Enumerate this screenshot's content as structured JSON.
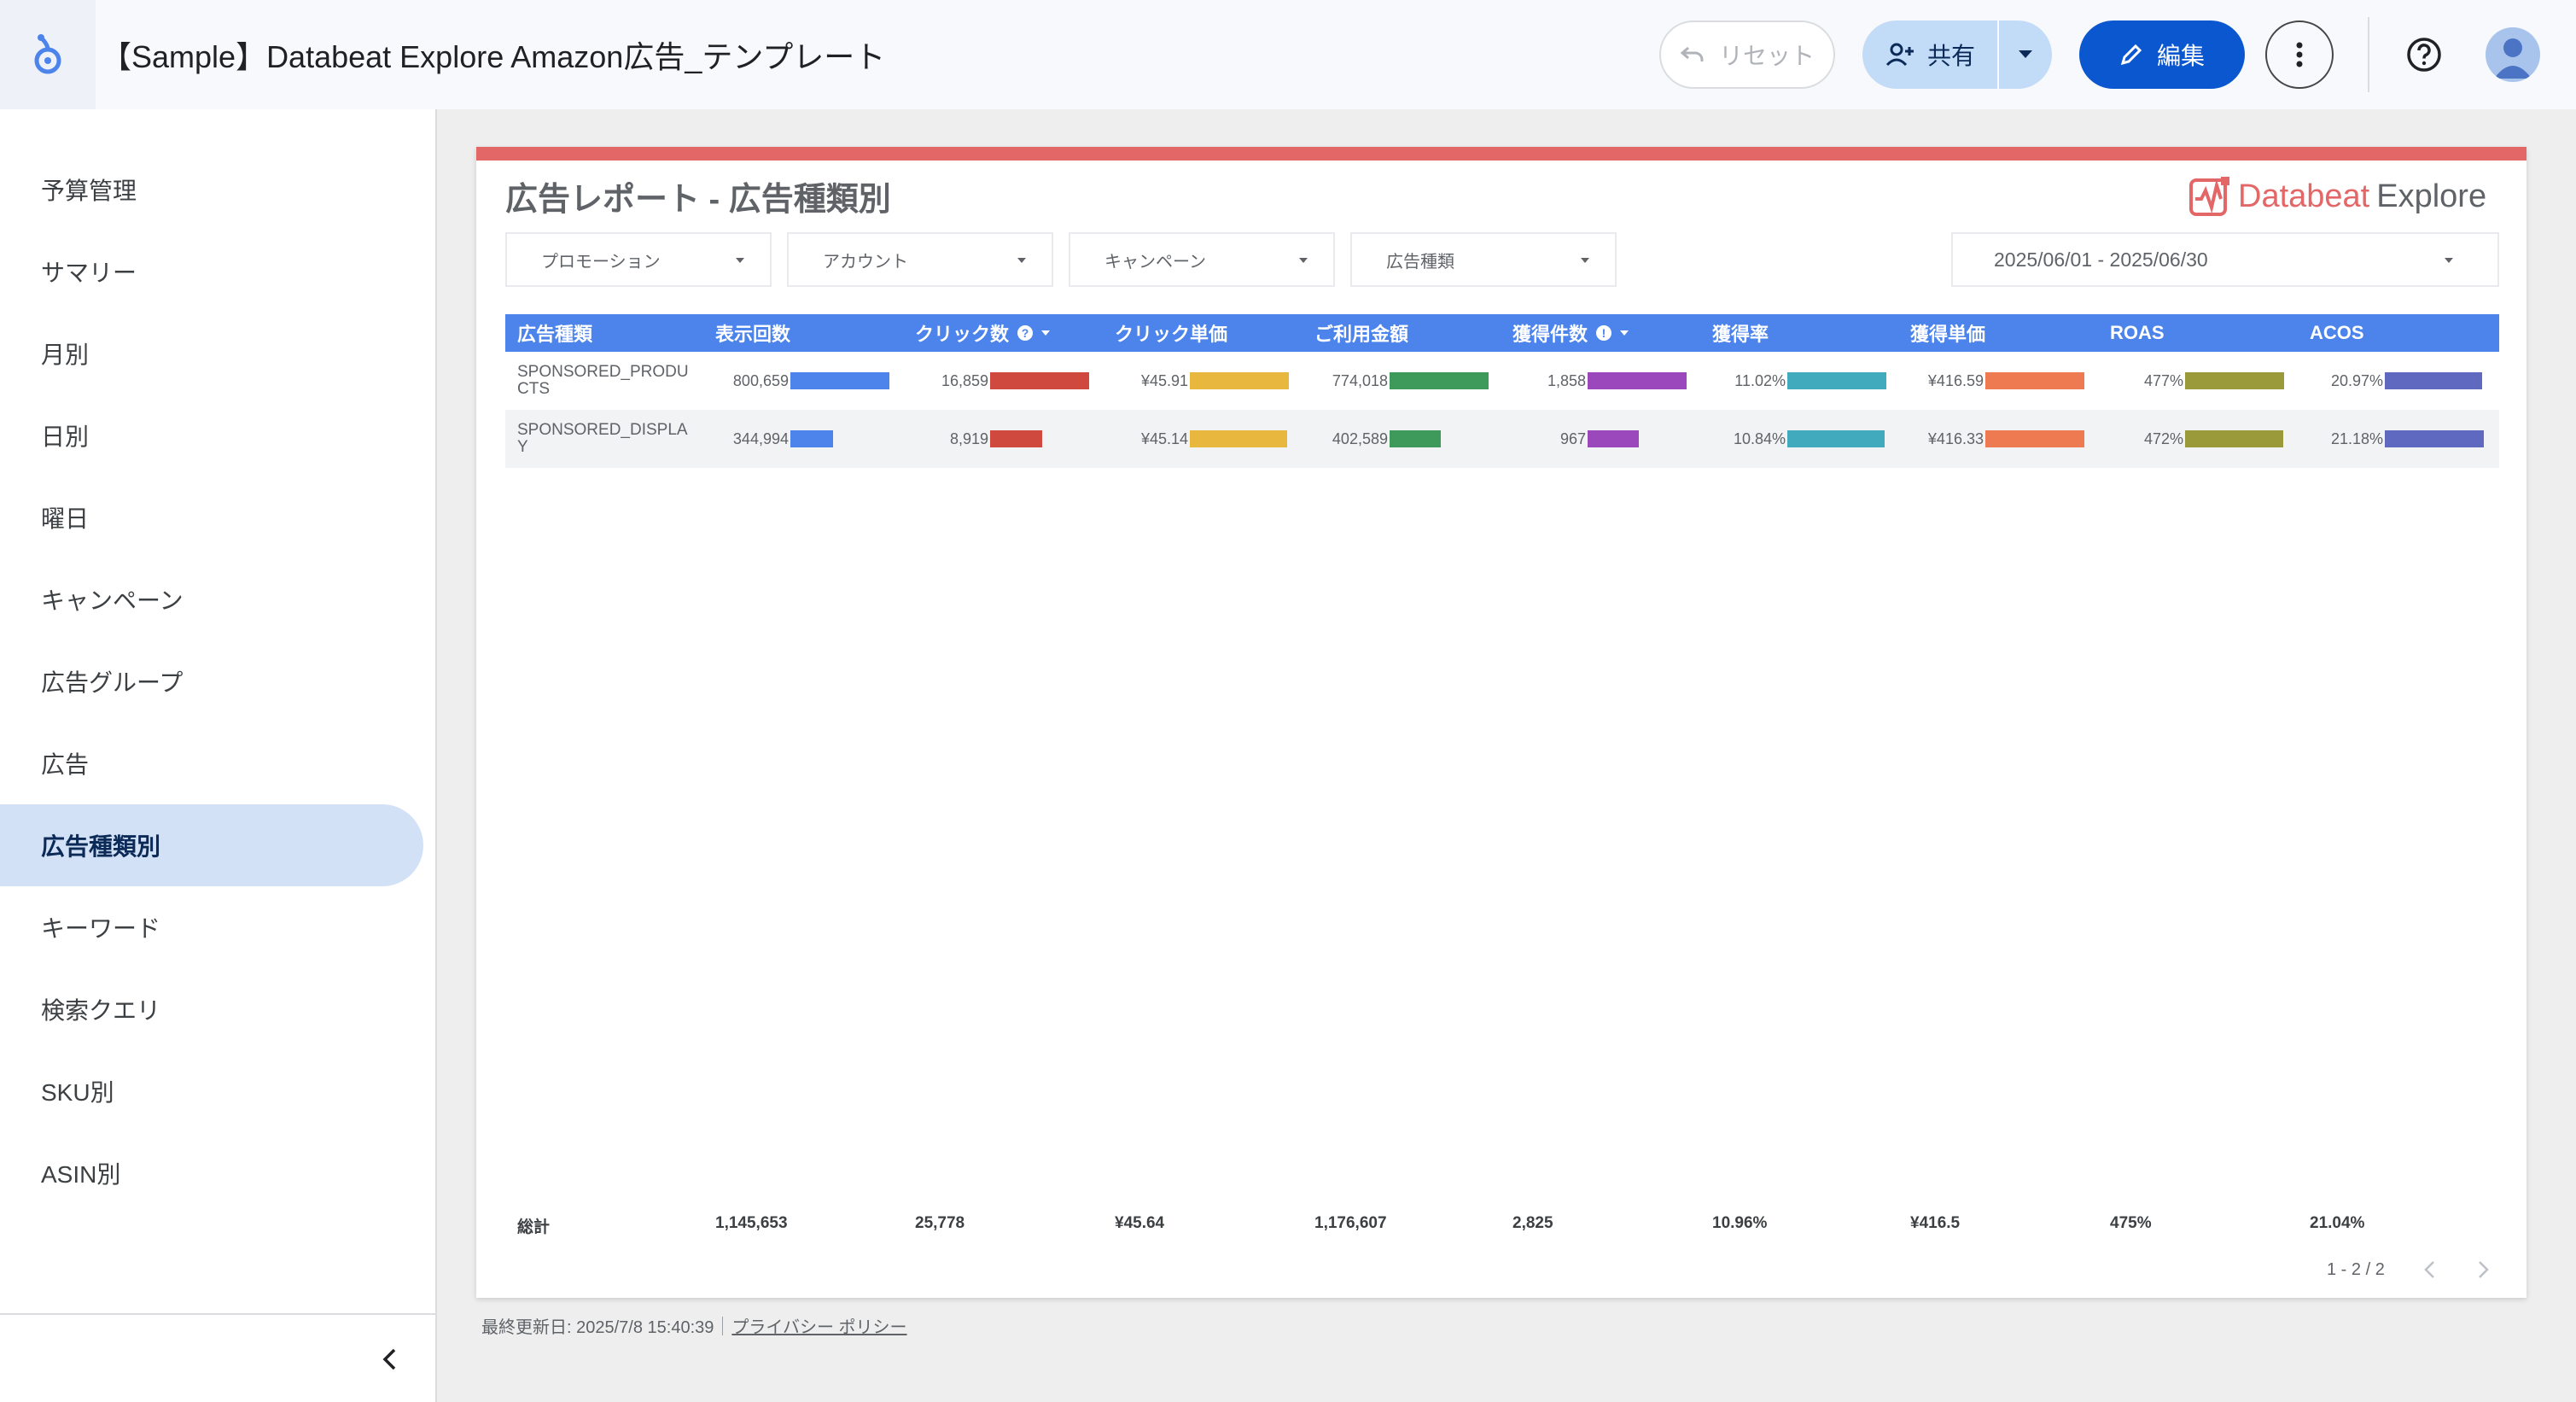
{
  "header": {
    "title": "【Sample】Databeat Explore Amazon広告_テンプレート",
    "reset_label": "リセット",
    "share_label": "共有",
    "edit_label": "編集"
  },
  "sidebar": {
    "items": [
      {
        "label": "予算管理"
      },
      {
        "label": "サマリー"
      },
      {
        "label": "月別"
      },
      {
        "label": "日別"
      },
      {
        "label": "曜日"
      },
      {
        "label": "キャンペーン"
      },
      {
        "label": "広告グループ"
      },
      {
        "label": "広告"
      },
      {
        "label": "広告種類別",
        "active": true
      },
      {
        "label": "キーワード"
      },
      {
        "label": "検索クエリ"
      },
      {
        "label": "SKU別"
      },
      {
        "label": "ASIN別"
      }
    ]
  },
  "report": {
    "title": "広告レポート - 広告種類別",
    "brand_a": "Databeat",
    "brand_b": "Explore",
    "filters": [
      "プロモーション",
      "アカウント",
      "キャンペーン",
      "広告種類"
    ],
    "date_range": "2025/06/01 - 2025/06/30",
    "columns": [
      "広告種類",
      "表示回数",
      "クリック数",
      "クリック単価",
      "ご利用金額",
      "獲得件数",
      "獲得率",
      "獲得単価",
      "ROAS",
      "ACOS"
    ],
    "rows": [
      {
        "name": "SPONSORED_PRODUCTS",
        "values": [
          "800,659",
          "16,859",
          "¥45.91",
          "774,018",
          "1,858",
          "11.02%",
          "¥416.59",
          "477%",
          "20.97%"
        ],
        "ratios": [
          1.0,
          1.0,
          1.0,
          1.0,
          1.0,
          1.0,
          1.0,
          1.0,
          0.98
        ]
      },
      {
        "name": "SPONSORED_DISPLAY",
        "values": [
          "344,994",
          "8,919",
          "¥45.14",
          "402,589",
          "967",
          "10.84%",
          "¥416.33",
          "472%",
          "21.18%"
        ],
        "ratios": [
          0.43,
          0.53,
          0.98,
          0.52,
          0.52,
          0.98,
          1.0,
          0.99,
          1.0
        ]
      }
    ],
    "totals_label": "総計",
    "totals": [
      "1,145,653",
      "25,778",
      "¥45.64",
      "1,176,607",
      "2,825",
      "10.96%",
      "¥416.5",
      "475%",
      "21.04%"
    ],
    "pager": "1 - 2 / 2",
    "bar_colors": [
      "#4c84ec",
      "#d0493e",
      "#e7b73e",
      "#3d9a5a",
      "#9b48bd",
      "#41aabd",
      "#ee7a52",
      "#9b9a3a",
      "#5f69c0"
    ]
  },
  "footer": {
    "updated": "最終更新日: 2025/7/8 15:40:39",
    "privacy": "プライバシー ポリシー"
  },
  "icons": {
    "logo": "looker-studio-logo-icon",
    "reset": "undo-icon",
    "share": "person-add-icon",
    "edit": "pencil-icon",
    "more": "more-vert-icon",
    "help": "help-icon",
    "collapse": "chevron-left-icon"
  }
}
